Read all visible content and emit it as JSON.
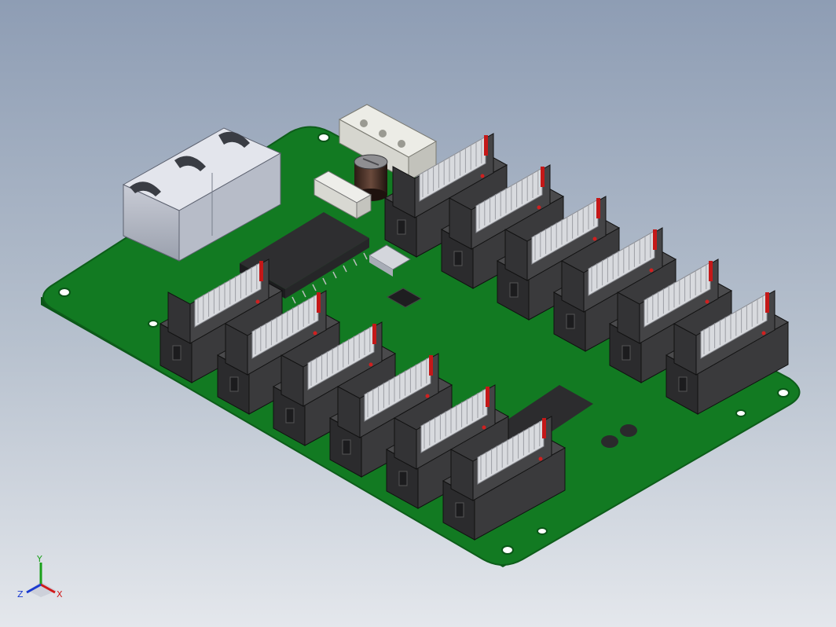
{
  "viewport": {
    "background_top": "#8e9db4",
    "background_bottom": "#e4e7ec"
  },
  "model": {
    "board_color": "#127a22",
    "board_edge_color": "#0a5517",
    "connector_count": 12,
    "components": [
      "rj45-dual-jack",
      "molex-power-connector",
      "electrolytic-capacitor",
      "pin-header",
      "ic-large-soic",
      "crystal-oscillator",
      "qfn-chip",
      "ic-long-soic",
      "inductors",
      "ffc-connectors"
    ]
  },
  "triad": {
    "x_label": "X",
    "y_label": "Y",
    "z_label": "Z",
    "x_color": "#d01a1a",
    "y_color": "#1aa01a",
    "z_color": "#1a3ad0"
  }
}
